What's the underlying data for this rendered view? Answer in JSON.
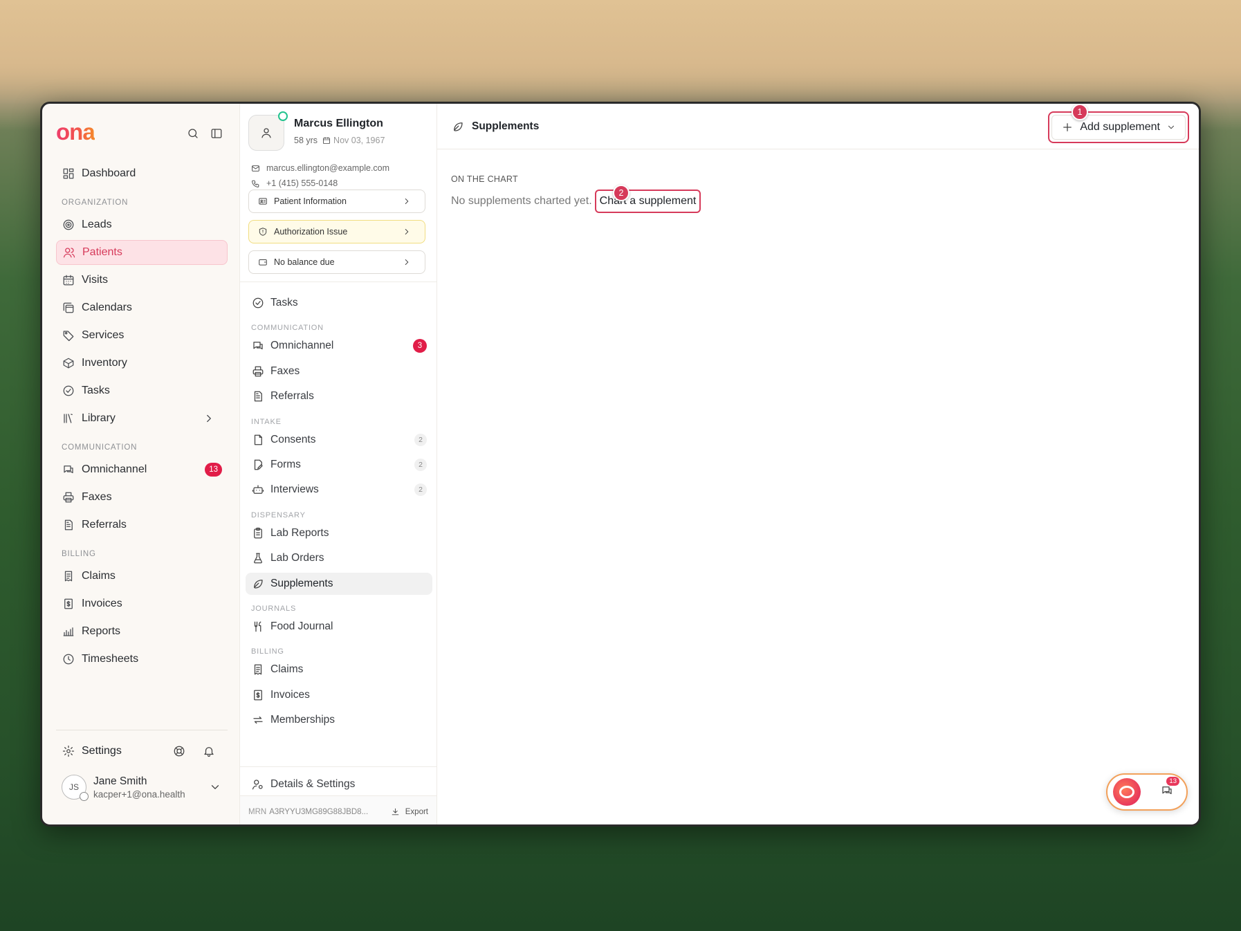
{
  "brand": {
    "logo_text": "ona",
    "gradient": [
      "#ee3d6c",
      "#f58b2a"
    ]
  },
  "colors": {
    "accent": "#d63a5a",
    "badge": "#e11d48",
    "online": "#22c38e",
    "warning_bg": "#fffbe8"
  },
  "sidebar": {
    "top": [
      {
        "label": "Dashboard",
        "icon": "grid-icon"
      }
    ],
    "sections": [
      {
        "title": "ORGANIZATION",
        "items": [
          {
            "label": "Leads",
            "icon": "target-icon"
          },
          {
            "label": "Patients",
            "icon": "users-icon",
            "active": true
          },
          {
            "label": "Visits",
            "icon": "calendar-grid-icon"
          },
          {
            "label": "Calendars",
            "icon": "calendars-icon"
          },
          {
            "label": "Services",
            "icon": "tag-icon"
          },
          {
            "label": "Inventory",
            "icon": "box-icon"
          },
          {
            "label": "Tasks",
            "icon": "check-circle-icon"
          },
          {
            "label": "Library",
            "icon": "library-icon",
            "chevron": true
          }
        ]
      },
      {
        "title": "COMMUNICATION",
        "items": [
          {
            "label": "Omnichannel",
            "icon": "chat-icon",
            "badge": "13"
          },
          {
            "label": "Faxes",
            "icon": "printer-icon"
          },
          {
            "label": "Referrals",
            "icon": "document-icon"
          }
        ]
      },
      {
        "title": "BILLING",
        "items": [
          {
            "label": "Claims",
            "icon": "receipt-icon"
          },
          {
            "label": "Invoices",
            "icon": "invoice-icon"
          },
          {
            "label": "Reports",
            "icon": "chart-icon"
          },
          {
            "label": "Timesheets",
            "icon": "clock-icon"
          }
        ]
      }
    ],
    "settings_label": "Settings",
    "user": {
      "initials": "JS",
      "name": "Jane Smith",
      "email": "kacper+1@ona.health"
    }
  },
  "patient": {
    "name": "Marcus Ellington",
    "age": "58 yrs",
    "dob": "Nov 03, 1967",
    "email": "marcus.ellington@example.com",
    "phone": "+1 (415) 555-0148",
    "cards": [
      {
        "label": "Patient Information",
        "icon": "id-card-icon"
      },
      {
        "label": "Authorization Issue",
        "icon": "shield-icon",
        "warning": true
      },
      {
        "label": "No balance due",
        "icon": "wallet-icon"
      }
    ],
    "nav": [
      {
        "type": "item",
        "label": "Tasks",
        "icon": "check-circle-icon"
      },
      {
        "type": "section",
        "label": "COMMUNICATION"
      },
      {
        "type": "item",
        "label": "Omnichannel",
        "icon": "chat-icon",
        "badge": "3"
      },
      {
        "type": "item",
        "label": "Faxes",
        "icon": "printer-icon"
      },
      {
        "type": "item",
        "label": "Referrals",
        "icon": "document-icon"
      },
      {
        "type": "section",
        "label": "INTAKE"
      },
      {
        "type": "item",
        "label": "Consents",
        "icon": "file-icon",
        "count": "2"
      },
      {
        "type": "item",
        "label": "Forms",
        "icon": "form-icon",
        "count": "2"
      },
      {
        "type": "item",
        "label": "Interviews",
        "icon": "bot-icon",
        "count": "2"
      },
      {
        "type": "section",
        "label": "DISPENSARY"
      },
      {
        "type": "item",
        "label": "Lab Reports",
        "icon": "clipboard-icon"
      },
      {
        "type": "item",
        "label": "Lab Orders",
        "icon": "flask-icon"
      },
      {
        "type": "item",
        "label": "Supplements",
        "icon": "leaf-icon",
        "active": true
      },
      {
        "type": "section",
        "label": "JOURNALS"
      },
      {
        "type": "item",
        "label": "Food Journal",
        "icon": "utensils-icon"
      },
      {
        "type": "section",
        "label": "BILLING"
      },
      {
        "type": "item",
        "label": "Claims",
        "icon": "receipt-icon"
      },
      {
        "type": "item",
        "label": "Invoices",
        "icon": "invoice-icon"
      },
      {
        "type": "item",
        "label": "Memberships",
        "icon": "repeat-icon"
      }
    ],
    "details_label": "Details & Settings",
    "mrn_label": "MRN",
    "mrn_value": "A3RYYU3MG89G88JBD8...",
    "export_label": "Export"
  },
  "main": {
    "title": "Supplements",
    "add_button": "Add supplement",
    "section_label": "ON THE CHART",
    "empty_text": "No supplements charted yet.",
    "chart_link": "Chart a supplement",
    "markers": [
      "1",
      "2"
    ],
    "widget_badge": "13"
  }
}
